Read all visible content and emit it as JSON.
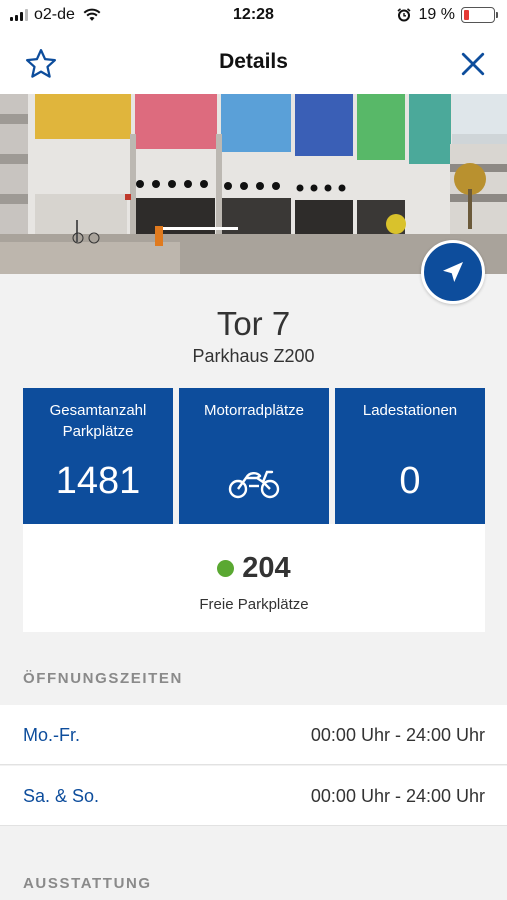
{
  "status_bar": {
    "carrier": "o2-de",
    "time": "12:28",
    "battery_percent": "19 %",
    "battery_level": 0.19
  },
  "nav": {
    "title": "Details",
    "favorite_icon": "star-outline-icon",
    "close_icon": "close-icon"
  },
  "hero": {
    "image": "parking-garage-photo",
    "navigate_icon": "navigation-arrow-icon"
  },
  "gate": {
    "name": "Tor 7",
    "facility": "Parkhaus Z200"
  },
  "tiles": [
    {
      "label": "Gesamtanzahl Parkplätze",
      "value": "1481"
    },
    {
      "label": "Motorradplätze",
      "icon": "motorcycle-icon"
    },
    {
      "label": "Ladestationen",
      "value": "0"
    }
  ],
  "availability": {
    "count": "204",
    "caption": "Freie Parkplätze",
    "status_color": "#5aa832"
  },
  "opening_hours": {
    "header": "ÖFFNUNGSZEITEN",
    "rows": [
      {
        "day": "Mo.-Fr.",
        "time": "00:00 Uhr - 24:00 Uhr"
      },
      {
        "day": "Sa. & So.",
        "time": "00:00 Uhr - 24:00 Uhr"
      }
    ]
  },
  "equipment": {
    "header": "AUSSTATTUNG"
  },
  "colors": {
    "brand_blue": "#0d4d9c",
    "available_green": "#5aa832"
  }
}
